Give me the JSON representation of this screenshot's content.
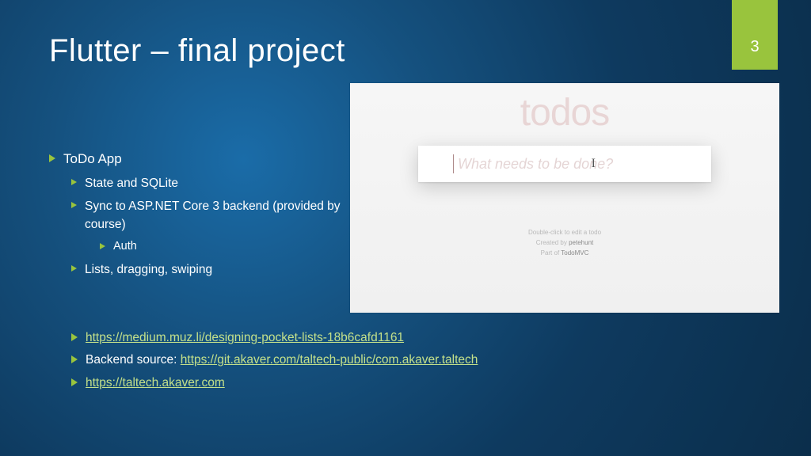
{
  "page_number": "3",
  "title": "Flutter – final project",
  "bullets": {
    "main": "ToDo App",
    "sub": [
      "State and SQLite",
      "Sync to ASP.NET Core 3 backend (provided by course)",
      "Lists, dragging, swiping"
    ],
    "subsub": [
      "Auth"
    ]
  },
  "links": {
    "l1": "https://medium.muz.li/designing-pocket-lists-18b6cafd1161",
    "l2_prefix": "Backend source: ",
    "l2": "https://git.akaver.com/taltech-public/com.akaver.taltech",
    "l3": "https://taltech.akaver.com"
  },
  "app": {
    "logo": "todos",
    "placeholder": "What needs to be done?",
    "footer_line1a": "Double-click to edit a todo",
    "footer_line2a": "Created by ",
    "footer_line2b": "petehunt",
    "footer_line3a": "Part of ",
    "footer_line3b": "TodoMVC"
  }
}
